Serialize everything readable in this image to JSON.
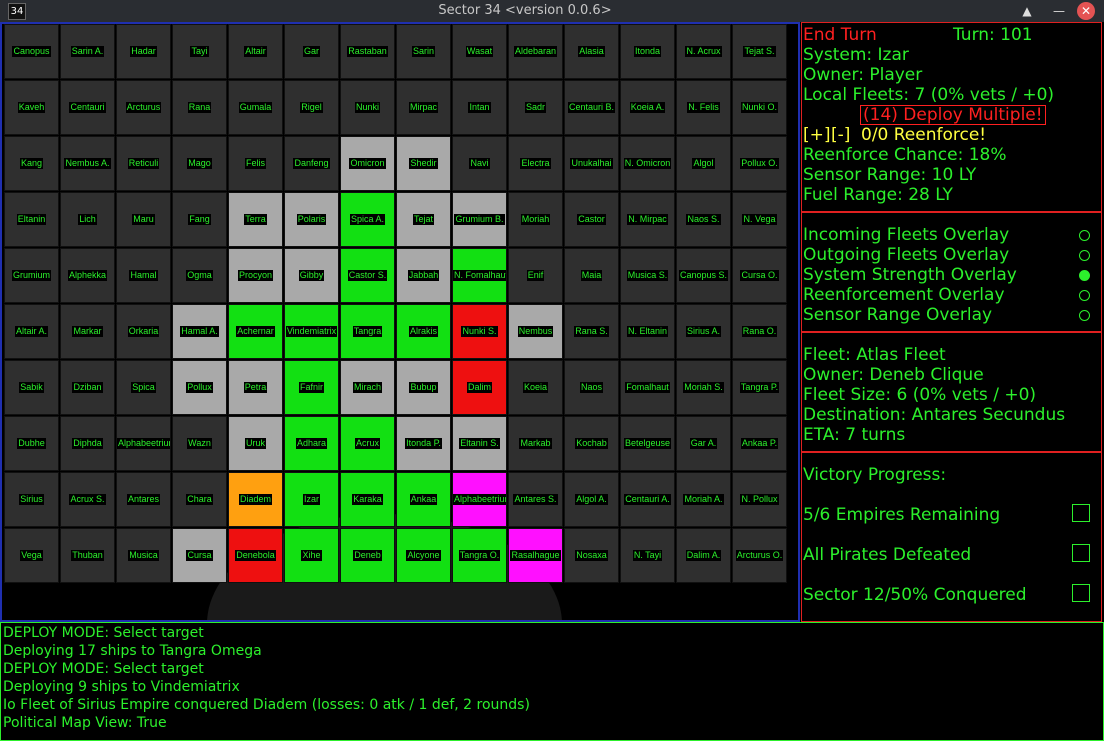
{
  "window": {
    "badge": "34",
    "title": "Sector 34   <version 0.0.6>"
  },
  "grid": {
    "rows": [
      [
        "Canopus",
        "Sarin A.",
        "Hadar",
        "Tayi",
        "Altair",
        "Gar",
        "Rastaban",
        "Sarin",
        "Wasat",
        "Aldebaran",
        "Alasia",
        "Itonda",
        "N. Acrux",
        "Tejat S."
      ],
      [
        "Kaveh",
        "Centauri",
        "Arcturus",
        "Rana",
        "Gumala",
        "Rigel",
        "Nunki",
        "Mirpac",
        "Intan",
        "Sadr",
        "Centauri B.",
        "Koeia A.",
        "N. Felis",
        "Nunki O."
      ],
      [
        "Kang",
        "Nembus A.",
        "Reticuli",
        "Mago",
        "Felis",
        "Danfeng",
        "Omicron",
        "Shedir",
        "Navi",
        "Electra",
        "Unukalhai",
        "N. Omicron",
        "Algol",
        "Pollux O."
      ],
      [
        "Eltanin",
        "Lich",
        "Maru",
        "Fang",
        "Terra",
        "Polaris",
        "Spica A.",
        "Tejat",
        "Grumium B.",
        "Moriah",
        "Castor",
        "N. Mirpac",
        "Naos S.",
        "N. Vega"
      ],
      [
        "Grumium",
        "Alphekka",
        "Hamal",
        "Ogma",
        "Procyon",
        "Gibby",
        "Castor S.",
        "Jabbah",
        "N. Fomalhaut",
        "Enif",
        "Maia",
        "Musica S.",
        "Canopus S.",
        "Cursa O."
      ],
      [
        "Altair A.",
        "Markar",
        "Orkaria",
        "Hamal A.",
        "Achernar",
        "Vindemiatrix",
        "Tangra",
        "Alrakis",
        "Nunki S.",
        "Nembus",
        "Rana S.",
        "N. Eltanin",
        "Sirius A.",
        "Rana O."
      ],
      [
        "Sabik",
        "Dziban",
        "Spica",
        "Pollux",
        "Petra",
        "Fafnir",
        "Mirach",
        "Bubup",
        "Dalim",
        "Koeia",
        "Naos",
        "Fomalhaut",
        "Moriah S.",
        "Tangra P."
      ],
      [
        "Dubhe",
        "Diphda",
        "Alphabeetrium",
        "Wazn",
        "Uruk",
        "Adhara",
        "Acrux",
        "Itonda P.",
        "Eltanin S.",
        "Markab",
        "Kochab",
        "Betelgeuse",
        "Gar A.",
        "Ankaa P."
      ],
      [
        "Sirius",
        "Acrux S.",
        "Antares",
        "Chara",
        "Diadem",
        "Izar",
        "Karaka",
        "Ankaa",
        "Alphabeetrium O.",
        "Antares S.",
        "Algol A.",
        "Centauri A.",
        "Moriah A.",
        "N. Pollux"
      ],
      [
        "Vega",
        "Thuban",
        "Musica",
        "Cursa",
        "Denebola",
        "Xihe",
        "Deneb",
        "Alcyone",
        "Tangra O.",
        "Rasalhague",
        "Nosaxa",
        "N. Tayi",
        "Dalim A.",
        "Arcturus O."
      ]
    ],
    "colors": [
      [
        "d",
        "d",
        "d",
        "d",
        "d",
        "d",
        "d",
        "d",
        "d",
        "d",
        "d",
        "d",
        "d",
        "d"
      ],
      [
        "d",
        "d",
        "d",
        "d",
        "d",
        "d",
        "d",
        "d",
        "d",
        "d",
        "d",
        "d",
        "d",
        "d"
      ],
      [
        "d",
        "d",
        "d",
        "d",
        "d",
        "d",
        "g",
        "g",
        "d",
        "d",
        "d",
        "d",
        "d",
        "d"
      ],
      [
        "d",
        "d",
        "d",
        "d",
        "g",
        "g",
        "G",
        "g",
        "g",
        "d",
        "d",
        "d",
        "d",
        "d"
      ],
      [
        "d",
        "d",
        "d",
        "d",
        "g",
        "g",
        "G",
        "g",
        "G",
        "d",
        "d",
        "d",
        "d",
        "d"
      ],
      [
        "d",
        "d",
        "d",
        "g",
        "G",
        "G",
        "G",
        "G",
        "r",
        "g",
        "d",
        "d",
        "d",
        "d"
      ],
      [
        "d",
        "d",
        "d",
        "g",
        "g",
        "G",
        "g",
        "g",
        "r",
        "d",
        "d",
        "d",
        "d",
        "d"
      ],
      [
        "d",
        "d",
        "d",
        "d",
        "g",
        "G",
        "G",
        "g",
        "g",
        "d",
        "d",
        "d",
        "d",
        "d"
      ],
      [
        "d",
        "d",
        "d",
        "d",
        "o",
        "G",
        "G",
        "G",
        "m",
        "d",
        "d",
        "d",
        "d",
        "d"
      ],
      [
        "d",
        "d",
        "d",
        "g",
        "r",
        "G",
        "G",
        "G",
        "G",
        "m",
        "d",
        "d",
        "d",
        "d"
      ]
    ],
    "palette": {
      "d": "#2f2f2f",
      "g": "#a9a9a9",
      "G": "#12e012",
      "r": "#ee1010",
      "o": "#ffa010",
      "m": "#ff10ff"
    }
  },
  "sidebar": {
    "end_turn": "End Turn",
    "turn": "Turn: 101",
    "system": "System: Izar",
    "owner": "Owner: Player",
    "local_fleets": "Local Fleets: 7 (0% vets / +0)",
    "deploy_multiple": "(14) Deploy Multiple!",
    "plus": "[+]",
    "minus": "[-]",
    "reenforce": "0/0 Reenforce!",
    "reenforce_chance": "Reenforce Chance: 18%",
    "sensor_range": "Sensor Range: 10 LY",
    "fuel_range": "Fuel Range: 28 LY",
    "overlays": [
      {
        "label": "Incoming Fleets Overlay",
        "active": false
      },
      {
        "label": "Outgoing Fleets Overlay",
        "active": false
      },
      {
        "label": "System Strength Overlay",
        "active": true
      },
      {
        "label": "Reenforcement Overlay",
        "active": false
      },
      {
        "label": "Sensor Range Overlay",
        "active": false
      }
    ],
    "fleet": {
      "name": "Fleet: Atlas Fleet",
      "owner": "Owner: Deneb Clique",
      "size": "Fleet Size: 6 (0% vets / +0)",
      "destination": "Destination: Antares Secundus",
      "eta": "ETA: 7 turns"
    },
    "victory": {
      "title": "Victory Progress:",
      "items": [
        "5/6 Empires Remaining",
        "All Pirates Defeated",
        "Sector 12/50% Conquered"
      ]
    }
  },
  "log": [
    "DEPLOY MODE: Select target",
    "Deploying 17 ships to Tangra Omega",
    "DEPLOY MODE: Select target",
    "Deploying 9 ships to Vindemiatrix",
    "Io Fleet of Sirius Empire conquered Diadem (losses: 0 atk / 1 def, 2 rounds)",
    "Political Map View: True"
  ]
}
